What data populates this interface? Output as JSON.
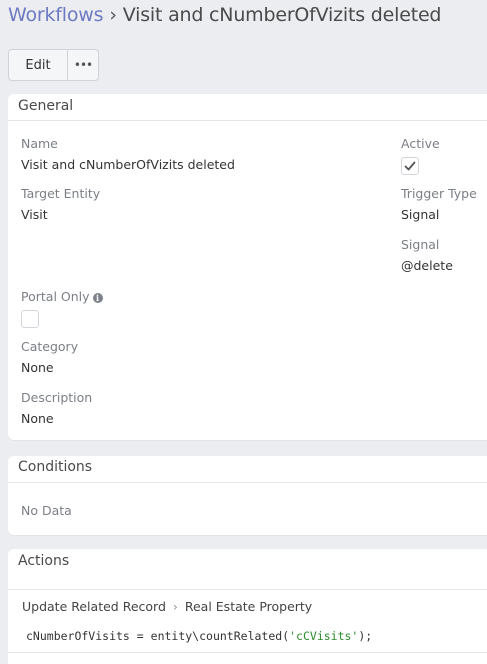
{
  "header": {
    "breadcrumb_root": "Workflows",
    "separator": "›",
    "title": "Visit and cNumberOfVizits deleted"
  },
  "toolbar": {
    "edit_label": "Edit",
    "more_label": "•••"
  },
  "general": {
    "title": "General",
    "name_label": "Name",
    "name_value": "Visit and cNumberOfVizits deleted",
    "active_label": "Active",
    "active_checked": true,
    "target_entity_label": "Target Entity",
    "target_entity_value": "Visit",
    "trigger_type_label": "Trigger Type",
    "trigger_type_value": "Signal",
    "signal_label": "Signal",
    "signal_value": "@delete",
    "portal_only_label": "Portal Only",
    "portal_only_checked": false,
    "category_label": "Category",
    "category_value": "None",
    "description_label": "Description",
    "description_value": "None"
  },
  "conditions": {
    "title": "Conditions",
    "empty_text": "No Data"
  },
  "actions": {
    "title": "Actions",
    "action_type": "Update Related Record",
    "action_sep": "›",
    "action_target": "Real Estate Property",
    "formula_lhs": "cNumberOfVisits",
    "formula_op": " = ",
    "formula_call": "entity\\countRelated(",
    "formula_string": "'cCVisits'",
    "formula_end": ");"
  },
  "colors": {
    "page_bg": "#ecedf1",
    "link": "#6d79c2",
    "label": "#7b7f86",
    "string_literal": "#2e8b2e"
  }
}
